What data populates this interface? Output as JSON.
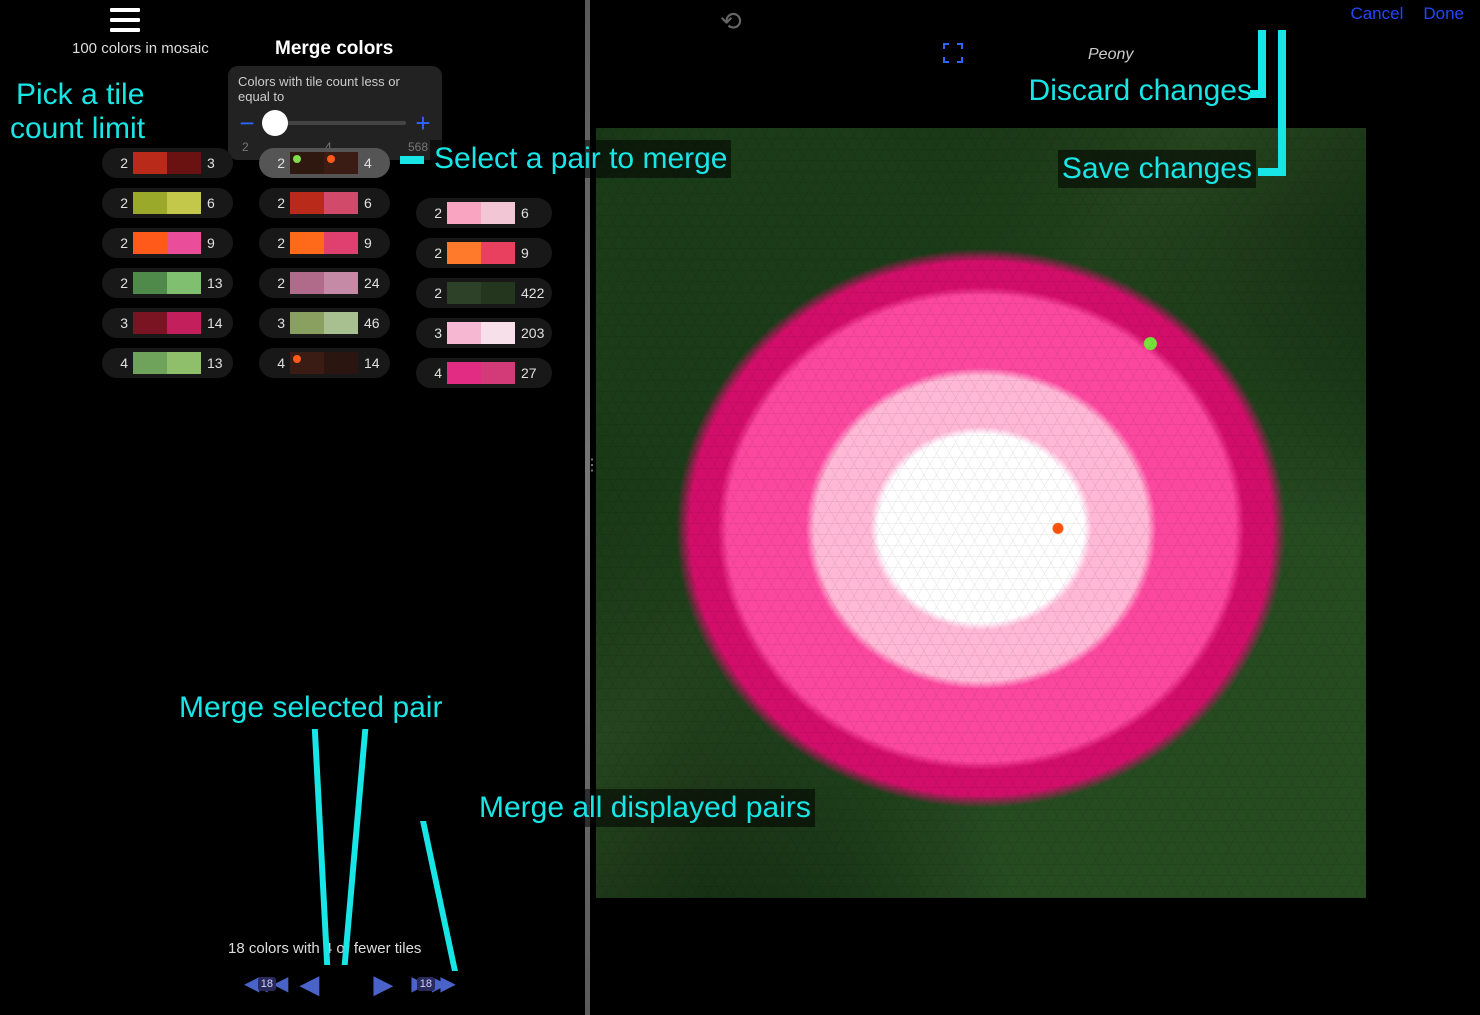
{
  "header": {
    "cancel": "Cancel",
    "done": "Done",
    "mosaic_count": "100 colors in mosaic",
    "merge_title": "Merge colors",
    "project_name": "Peony"
  },
  "slider": {
    "label": "Colors with tile count less or equal to",
    "min": "2",
    "value": "4",
    "max": "568"
  },
  "columns": [
    [
      {
        "left_count": "2",
        "c1": "#b92a1a",
        "c2": "#6a1212",
        "right_count": "3"
      },
      {
        "left_count": "2",
        "c1": "#9aa92a",
        "c2": "#c3c84a",
        "right_count": "6"
      },
      {
        "left_count": "2",
        "c1": "#ff5a1a",
        "c2": "#ea4e9a",
        "right_count": "9"
      },
      {
        "left_count": "2",
        "c1": "#4f8a4a",
        "c2": "#7fbf6f",
        "right_count": "13"
      },
      {
        "left_count": "3",
        "c1": "#7a1422",
        "c2": "#c21f5c",
        "right_count": "14"
      },
      {
        "left_count": "4",
        "c1": "#6fa35c",
        "c2": "#8fbf6a",
        "right_count": "13"
      }
    ],
    [
      {
        "left_count": "2",
        "c1": "#2f1810",
        "d1": "#7fdc4a",
        "c2": "#3a1c14",
        "d2": "#ff5a1a",
        "right_count": "4",
        "selected": true
      },
      {
        "left_count": "2",
        "c1": "#b92a1a",
        "c2": "#d24a6a",
        "right_count": "6"
      },
      {
        "left_count": "2",
        "c1": "#ff6a1a",
        "c2": "#e04070",
        "right_count": "9"
      },
      {
        "left_count": "2",
        "c1": "#b06a8a",
        "c2": "#c58aa5",
        "right_count": "24"
      },
      {
        "left_count": "3",
        "c1": "#8aa060",
        "c2": "#a8c090",
        "right_count": "46"
      },
      {
        "left_count": "4",
        "c1": "#3a1c14",
        "d1": "#ff5a1a",
        "c2": "#2b1510",
        "right_count": "14"
      }
    ],
    [
      {
        "left_count": "2",
        "c1": "#f9a5c2",
        "c2": "#f3c6d6",
        "right_count": "6"
      },
      {
        "left_count": "2",
        "c1": "#ff7a2a",
        "c2": "#ea4060",
        "right_count": "9"
      },
      {
        "left_count": "2",
        "c1": "#2d4028",
        "c2": "#25361f",
        "right_count": "422"
      },
      {
        "left_count": "3",
        "c1": "#f5b7d1",
        "c2": "#f8e0ea",
        "right_count": "203"
      },
      {
        "left_count": "4",
        "c1": "#e22b82",
        "c2": "#d23a78",
        "right_count": "27"
      }
    ]
  ],
  "footer": {
    "status": "18 colors with 4 or fewer tiles",
    "badge": "18"
  },
  "annotations": {
    "pick_limit_1": "Pick a tile",
    "pick_limit_2": "count limit",
    "select_pair": "Select a pair to merge",
    "discard": "Discard changes",
    "save": "Save changes",
    "merge_selected": "Merge selected pair",
    "merge_all": "Merge all displayed pairs"
  }
}
